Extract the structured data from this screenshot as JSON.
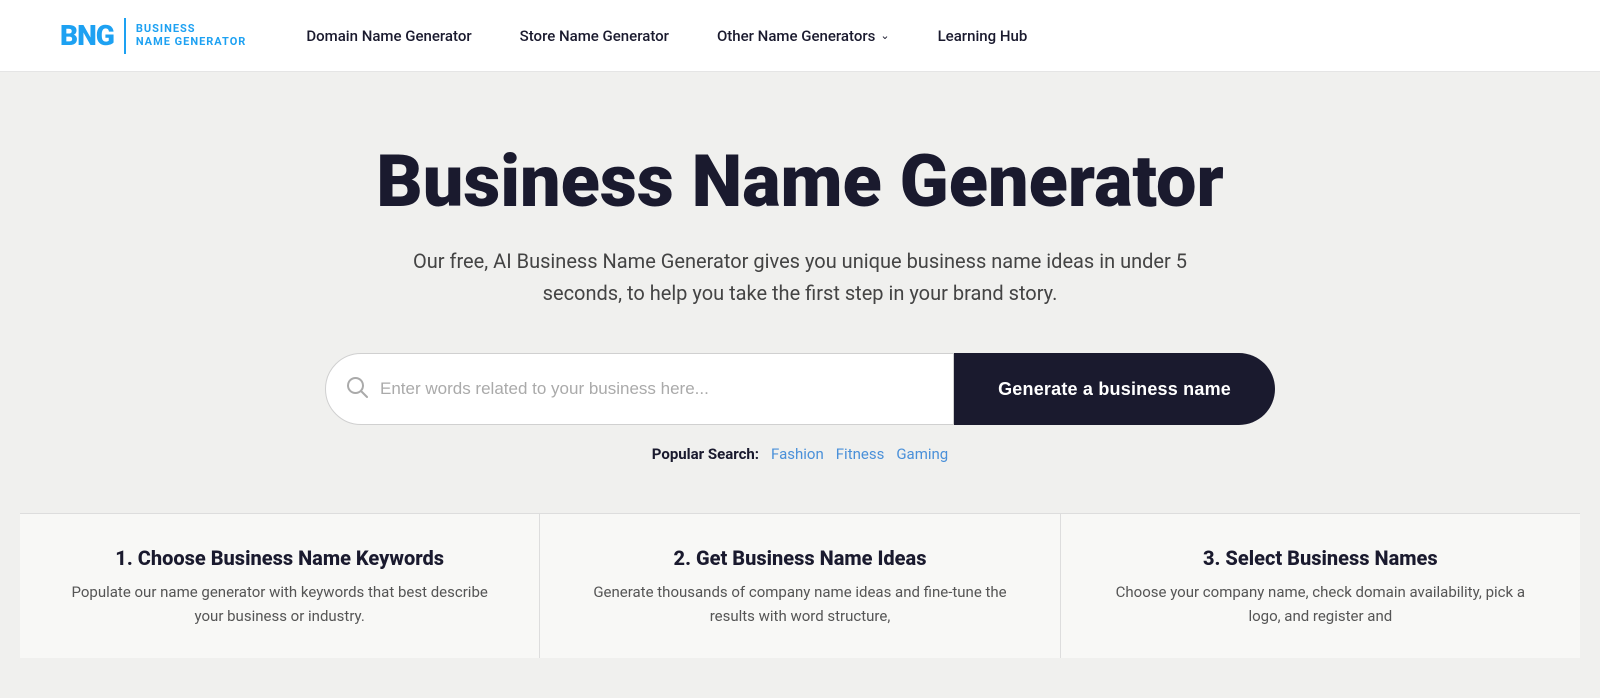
{
  "logo": {
    "bng": "BNG",
    "business": "BUSINESS",
    "name_generator": "NAME GENERATOR"
  },
  "nav": {
    "items": [
      {
        "label": "Domain Name Generator",
        "has_arrow": false
      },
      {
        "label": "Store Name Generator",
        "has_arrow": false
      },
      {
        "label": "Other Name Generators",
        "has_arrow": true
      },
      {
        "label": "Learning Hub",
        "has_arrow": false
      }
    ]
  },
  "hero": {
    "title": "Business Name Generator",
    "subtitle": "Our free, AI Business Name Generator gives you unique business name ideas in under 5 seconds, to help you take the first step in your brand story.",
    "search": {
      "placeholder": "Enter words related to your business here...",
      "button_label": "Generate a business name"
    },
    "popular_search": {
      "label": "Popular Search:",
      "tags": [
        "Fashion",
        "Fitness",
        "Gaming"
      ]
    }
  },
  "steps": [
    {
      "number": "1.",
      "title": "Choose Business Name Keywords",
      "description": "Populate our name generator with keywords that best describe your business or industry."
    },
    {
      "number": "2.",
      "title": "Get Business Name Ideas",
      "description": "Generate thousands of company name ideas and fine-tune the results with word structure,"
    },
    {
      "number": "3.",
      "title": "Select Business Names",
      "description": "Choose your company name, check domain availability, pick a logo, and register and"
    }
  ],
  "colors": {
    "brand_blue": "#1da1f2",
    "dark": "#1a1a2e",
    "link_blue": "#4a90d9",
    "bg": "#f0f0ee"
  }
}
